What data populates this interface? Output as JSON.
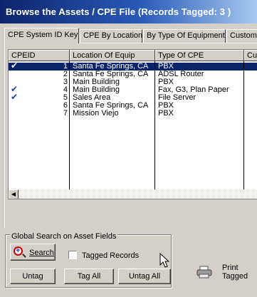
{
  "window": {
    "title": "Browse the Assets / CPE File  (Records Tagged:  3 )"
  },
  "tabs": [
    {
      "label": "CPE System ID Key",
      "active": true
    },
    {
      "label": "CPE By Location",
      "active": false
    },
    {
      "label": "By Type Of Equipment",
      "active": false
    },
    {
      "label": "Custom",
      "active": false
    }
  ],
  "table": {
    "columns": [
      "CPEID",
      "Location Of Equip",
      "Type Of CPE",
      "Cu"
    ],
    "rows": [
      {
        "id": "1",
        "location": "Santa Fe Springs, CA",
        "type": "PBX",
        "tagged": true,
        "selected": true
      },
      {
        "id": "2",
        "location": "Santa Fe Springs, CA",
        "type": "ADSL Router",
        "tagged": false,
        "selected": false
      },
      {
        "id": "3",
        "location": "Main Building",
        "type": "PBX",
        "tagged": false,
        "selected": false
      },
      {
        "id": "4",
        "location": "Main Building",
        "type": "Fax, G3, Plan Paper",
        "tagged": true,
        "selected": false
      },
      {
        "id": "5",
        "location": "Sales Area",
        "type": "File Server",
        "tagged": true,
        "selected": false
      },
      {
        "id": "6",
        "location": "Santa Fe Springs, CA",
        "type": "PBX",
        "tagged": false,
        "selected": false
      },
      {
        "id": "7",
        "location": "Mission Viejo",
        "type": "PBX",
        "tagged": false,
        "selected": false
      }
    ]
  },
  "search_group": {
    "title": "Global Search on Asset Fields",
    "search_button": "Search",
    "tagged_records_label": "Tagged Records",
    "tagged_records_checked": false
  },
  "buttons": {
    "untag": "Untag",
    "tag_all": "Tag All",
    "untag_all": "Untag All"
  },
  "print": {
    "line1": "Print",
    "line2": "Tagged"
  },
  "colors": {
    "title_start": "#0a246a",
    "title_end": "#a6caf0",
    "selection": "#0a246a",
    "face": "#d4d0c8"
  }
}
